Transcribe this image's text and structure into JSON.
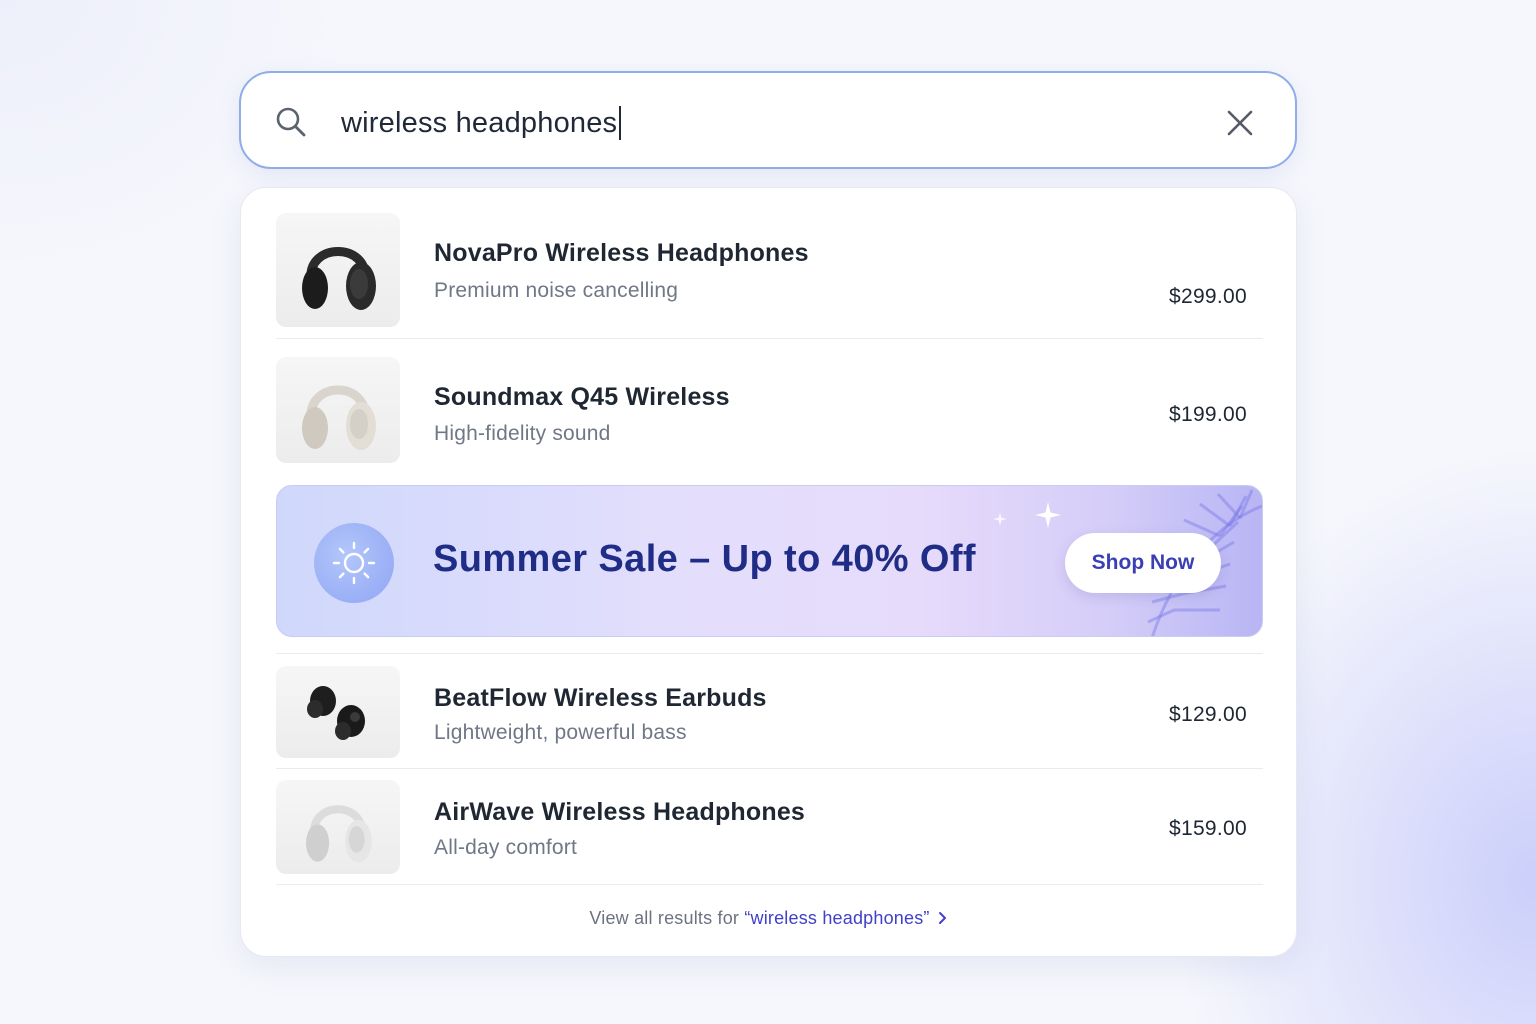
{
  "search": {
    "query": "wireless headphones"
  },
  "results": [
    {
      "name": "NovaPro Wireless Headphones",
      "desc": "Premium noise cancelling",
      "price": "$299.00"
    },
    {
      "name": "Soundmax Q45 Wireless",
      "desc": "High-fidelity sound",
      "price": "$199.00"
    },
    {
      "name": "BeatFlow Wireless Earbuds",
      "desc": "Lightweight, powerful bass",
      "price": "$129.00"
    },
    {
      "name": "AirWave Wireless Headphones",
      "desc": "All-day comfort",
      "price": "$159.00"
    }
  ],
  "promo": {
    "title": "Summer Sale – Up to 40% Off",
    "button": "Shop Now"
  },
  "footer": {
    "prefix": "View all results for ",
    "query_link": "“wireless headphones”"
  },
  "colors": {
    "accent": "#4240c9",
    "searchbar_border": "#8fadea",
    "promo_title": "#1f2d86"
  },
  "icons": [
    "search-icon",
    "close-icon",
    "sun-icon",
    "chevron-right-icon",
    "sparkle-icon"
  ]
}
